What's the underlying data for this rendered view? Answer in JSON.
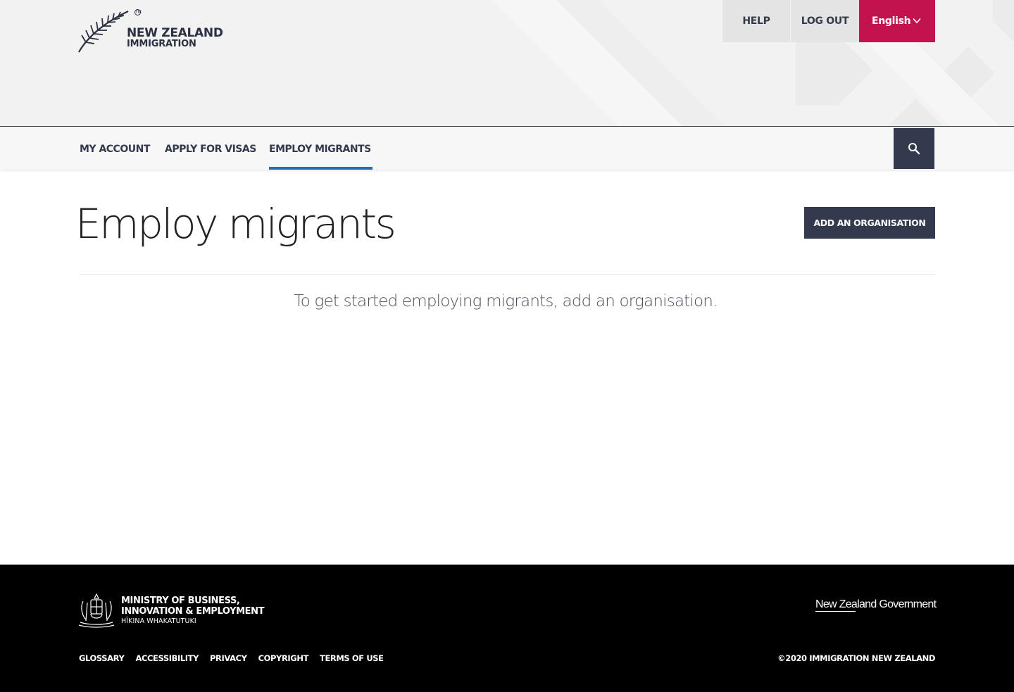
{
  "brand": {
    "logo_line1": "NEW ZEALAND",
    "logo_line2": "IMMIGRATION",
    "logo_icon": "silver-fern-icon",
    "tm": "TM"
  },
  "top_links": {
    "help": "HELP",
    "logout": "LOG OUT",
    "language": "English"
  },
  "nav": {
    "items": [
      {
        "label": "MY ACCOUNT",
        "active": false
      },
      {
        "label": "APPLY FOR VISAS",
        "active": false
      },
      {
        "label": "EMPLOY MIGRANTS",
        "active": true
      }
    ],
    "search_icon": "search-icon"
  },
  "main": {
    "title": "Employ migrants",
    "add_org_button": "ADD AN ORGANISATION",
    "intro": "To get started employing migrants, add an organisation."
  },
  "footer": {
    "mbie_line1": "MINISTRY OF BUSINESS,",
    "mbie_line2": "INNOVATION & EMPLOYMENT",
    "mbie_line3": "HĪKINA WHAKATUTUKI",
    "nz_gov": "New Zealand Government",
    "links": [
      "GLOSSARY",
      "ACCESSIBILITY",
      "PRIVACY",
      "COPYRIGHT",
      "TERMS OF USE"
    ],
    "copyright": "©2020 IMMIGRATION NEW ZEALAND"
  },
  "colors": {
    "navy": "#333a4d",
    "accent_red": "#c3134f",
    "active_blue": "#1f6fb5",
    "header_bg": "#f2f2f2",
    "footer_bg": "#000000"
  }
}
